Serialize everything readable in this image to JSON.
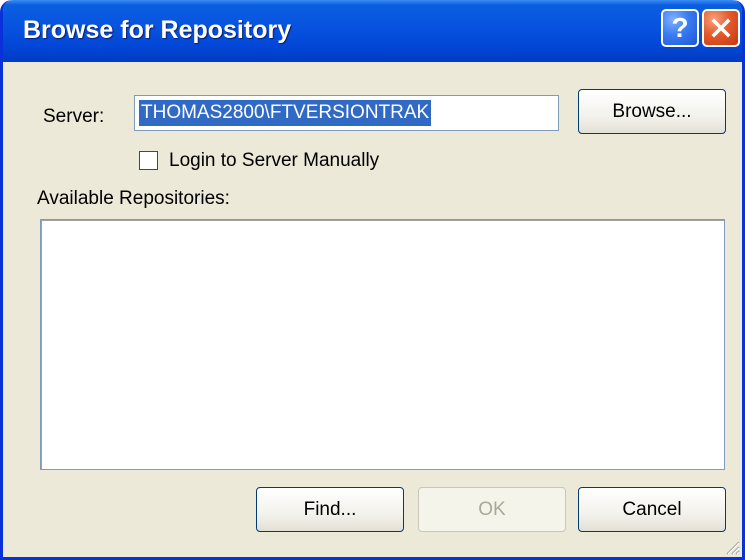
{
  "window": {
    "title": "Browse for Repository",
    "help_button_label": "?",
    "close_button_icon": "close-x-icon"
  },
  "server": {
    "label": "Server:",
    "value": "THOMAS2800\\FTVERSIONTRAK",
    "browse_label": "Browse..."
  },
  "login_manually": {
    "label": "Login to Server Manually",
    "checked": false
  },
  "repositories": {
    "label": "Available Repositories:",
    "items": []
  },
  "buttons": {
    "find_label": "Find...",
    "ok_label": "OK",
    "cancel_label": "Cancel"
  },
  "colors": {
    "titlebar": "#0854e0",
    "dialog_face": "#ece9d8",
    "selection": "#316ac5",
    "close_button": "#e45a2c"
  }
}
